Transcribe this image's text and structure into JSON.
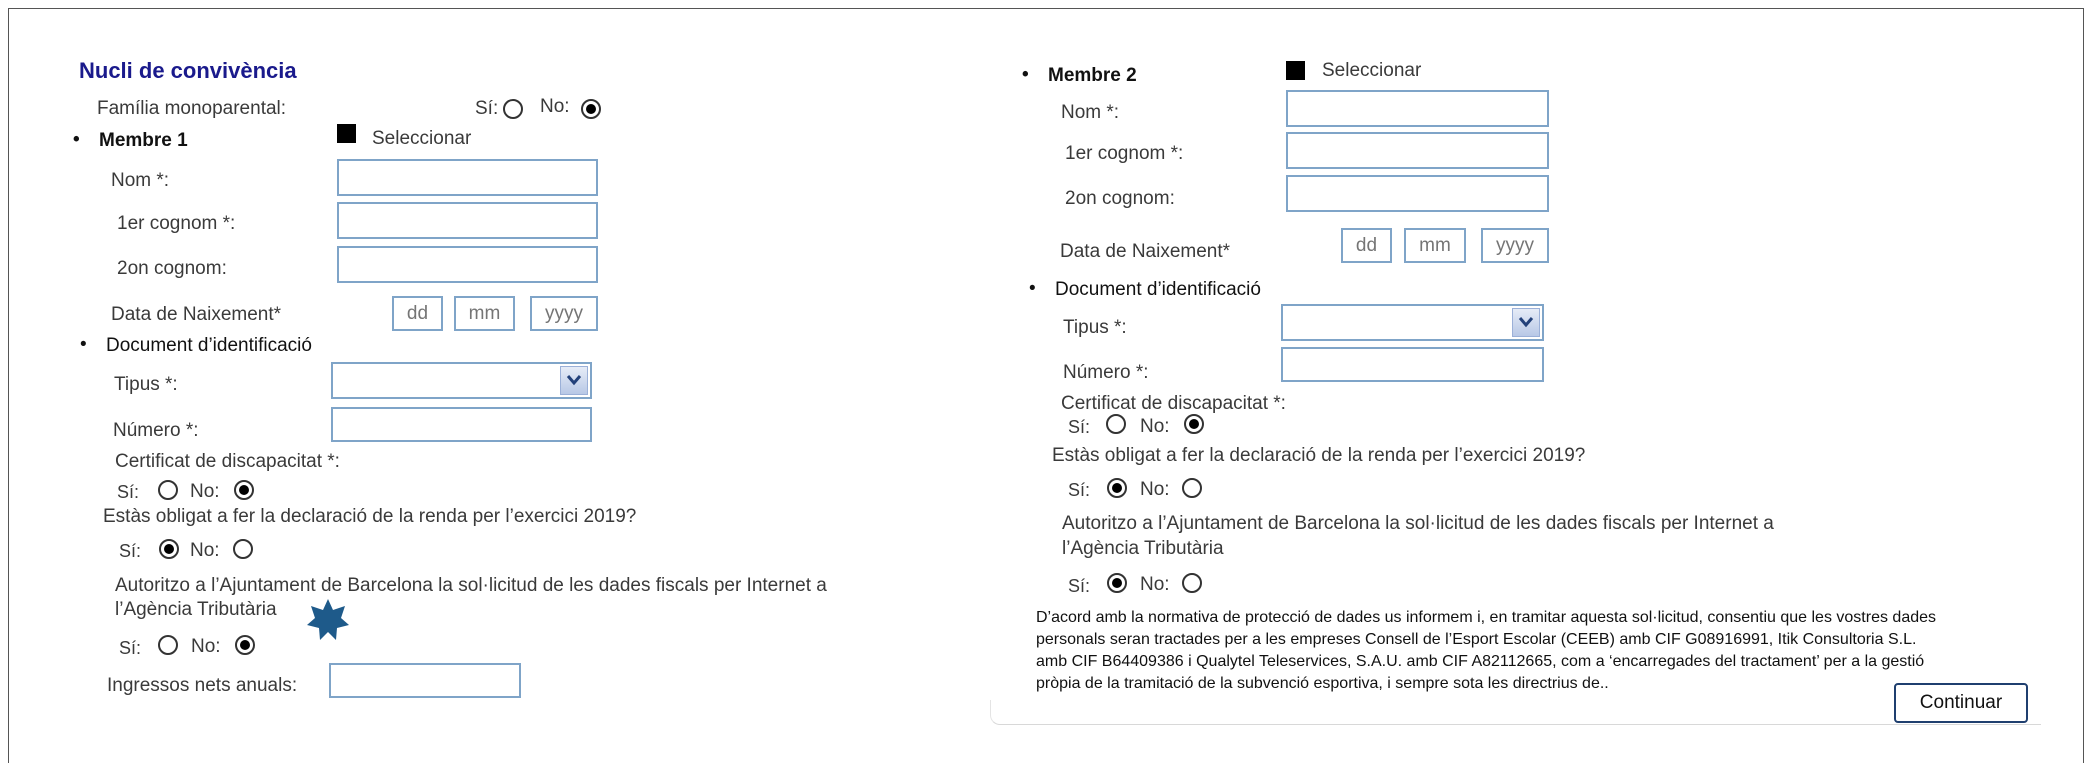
{
  "section_title": "Nucli de convivència",
  "single_parent": {
    "label": "Família monoparental:",
    "yes": "Sí:",
    "no": "No:",
    "selected": "no"
  },
  "member1": {
    "title": "Membre 1",
    "select_label": "Seleccionar",
    "name_label": "Nom *:",
    "surname1_label": "1er cognom *:",
    "surname2_label": "2on cognom:",
    "birth_label": "Data de Naixement*",
    "day_ph": "dd",
    "month_ph": "mm",
    "year_ph": "yyyy",
    "doc_title": "Document d’identificació",
    "type_label": "Tipus *:",
    "number_label": "Número *:",
    "disability_label": "Certificat de discapacitat *:",
    "disability_selected": "no",
    "tax_question": "Estàs obligat a fer  la declaració de la renda per l’exercici 2019?",
    "tax_selected": "yes",
    "authorize_line1": "Autoritzo a l’Ajuntament de Barcelona la sol·licitud de les dades fiscals per Internet a",
    "authorize_line2": "l’Agència Tributària",
    "authorize_selected": "no",
    "income_label": "Ingressos nets anuals:",
    "yes": "Sí:",
    "no": "No:"
  },
  "member2": {
    "title": "Membre 2",
    "select_label": "Seleccionar",
    "name_label": "Nom *:",
    "surname1_label": "1er cognom *:",
    "surname2_label": "2on cognom:",
    "birth_label": "Data de Naixement*",
    "day_ph": "dd",
    "month_ph": "mm",
    "year_ph": "yyyy",
    "doc_title": "Document d’identificació",
    "type_label": "Tipus *:",
    "number_label": "Número *:",
    "disability_label": "Certificat de discapacitat *:",
    "disability_selected": "no",
    "tax_question": "Estàs obligat a fer  la declaració de la renda per l’exercici 2019?",
    "tax_selected": "yes",
    "authorize_line1": "Autoritzo a l’Ajuntament de Barcelona la sol·licitud de les dades fiscals per Internet a",
    "authorize_line2": "l’Agència Tributària",
    "authorize_selected": "yes",
    "yes": "Sí:",
    "no": "No:"
  },
  "privacy_notice": "D’acord amb la normativa de protecció de dades us informem i, en tramitar aquesta sol·licitud, consentiu que les vostres dades personals seran tractades per a les empreses Consell de l’Esport Escolar (CEEB) amb CIF G08916991, Itik Consultoria S.L. amb CIF B64409386 i Qualytel Teleservices, S.A.U. amb CIF A82112665, com a ‘encarregades del tractament’ per a la gestió pròpia de la tramitació de la subvenció esportiva, i sempre sota les directrius de..",
  "continue_button": "Continuar",
  "colors": {
    "title": "#1a1a8c",
    "field_border": "#7fa4c8",
    "star": "#1e5a8a"
  },
  "icons": [
    "checkbox-filled-icon",
    "dropdown-chevron-icon",
    "star-badge-icon"
  ]
}
